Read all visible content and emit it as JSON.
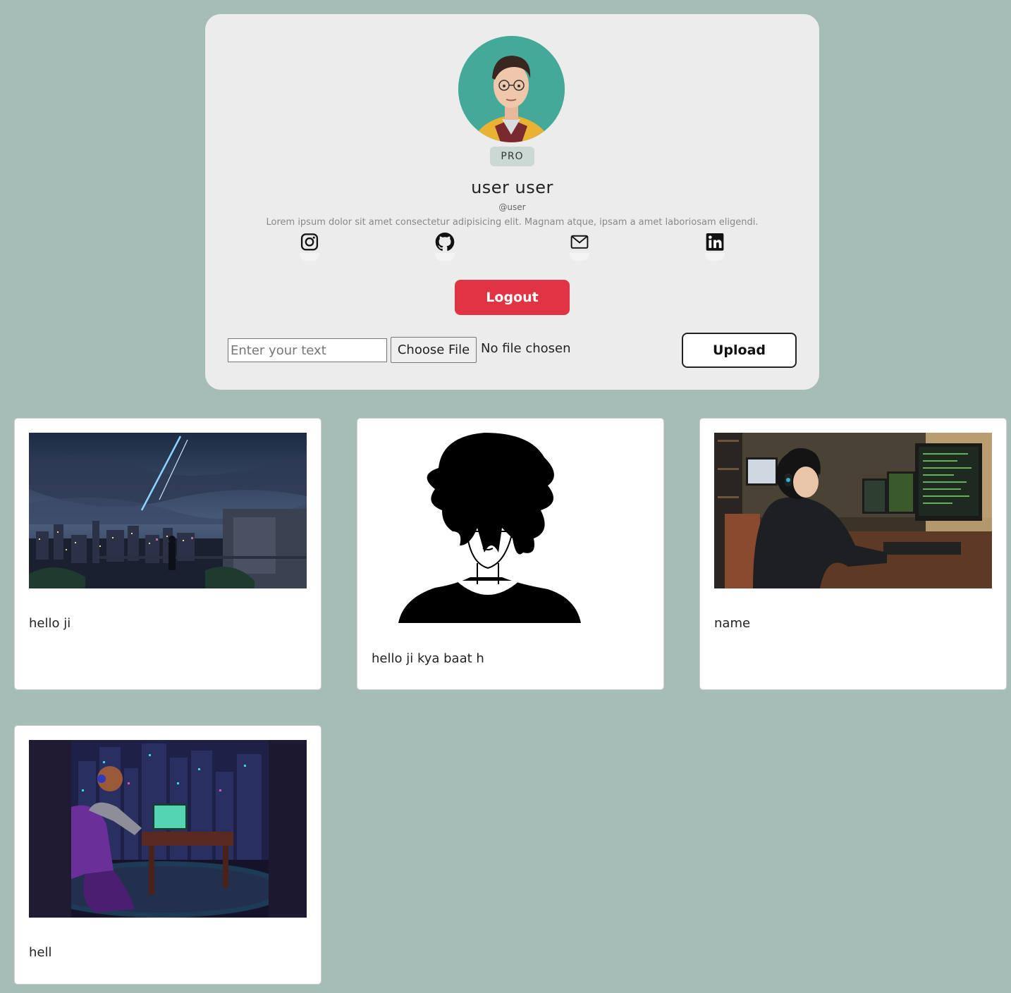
{
  "profile": {
    "badge": "PRO",
    "name": "user user",
    "handle": "@user",
    "bio": "Lorem ipsum dolor sit amet consectetur adipisicing elit. Magnam atque, ipsam a amet laboriosam eligendi.",
    "social_links": [
      "instagram-icon",
      "github-icon",
      "mail-icon",
      "linkedin-icon"
    ],
    "logout_label": "Logout"
  },
  "upload_form": {
    "text_placeholder": "Enter your text",
    "text_value": "",
    "choose_file_label": "Choose File",
    "file_status": "No file chosen",
    "upload_label": "Upload"
  },
  "posts": [
    {
      "caption": "hello ji",
      "image": "night-city-sky-illustration"
    },
    {
      "caption": "hello ji kya baat h",
      "image": "anime-boy-silhouette"
    },
    {
      "caption": "name",
      "image": "boy-at-computer-desk"
    },
    {
      "caption": "hell",
      "image": "gamer-room-neon-city"
    }
  ],
  "colors": {
    "background": "#a5bdb6",
    "card": "#ececec",
    "logout": "#e03444",
    "badge": "#cbd8d4"
  }
}
